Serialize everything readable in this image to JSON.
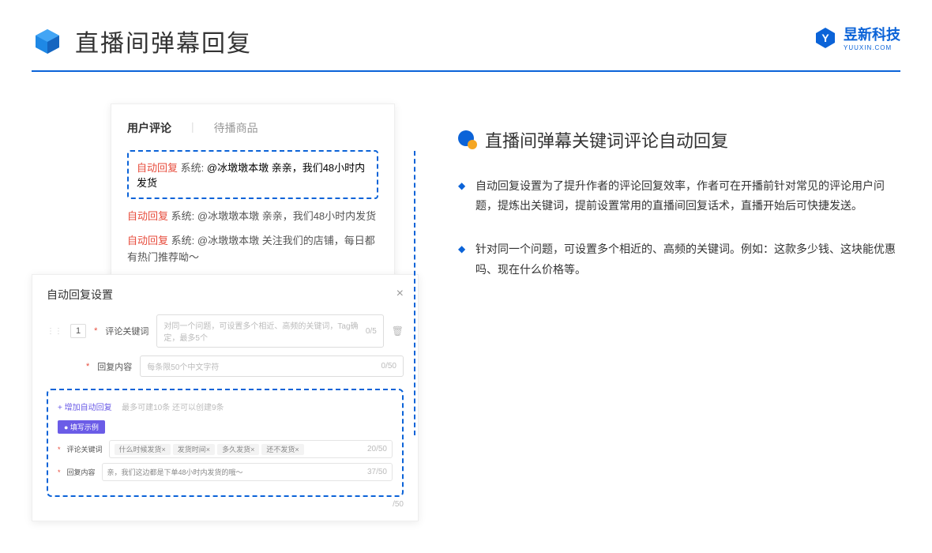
{
  "header": {
    "title": "直播间弹幕回复"
  },
  "logo": {
    "text": "昱新科技",
    "url": "YUUXIN.COM"
  },
  "top_panel": {
    "tab_active": "用户评论",
    "tab_inactive": "待播商品",
    "highlighted_msg": {
      "auto": "自动回复",
      "sys": "系统:",
      "content": "@冰墩墩本墩 亲亲，我们48小时内发货"
    },
    "msg2": {
      "auto": "自动回复",
      "sys": "系统:",
      "content": "@冰墩墩本墩 亲亲，我们48小时内发货"
    },
    "msg3": {
      "auto": "自动回复",
      "sys": "系统:",
      "content": "@冰墩墩本墩 关注我们的店铺，每日都有热门推荐呦～"
    }
  },
  "dialog": {
    "title": "自动回复设置",
    "num": "1",
    "kw_label": "评论关键词",
    "kw_placeholder": "对同一个问题，可设置多个相近、高频的关键词，Tag确定，最多5个",
    "kw_counter": "0/5",
    "content_label": "回复内容",
    "content_placeholder": "每条限50个中文字符",
    "content_counter": "0/50",
    "add_link": "+ 增加自动回复",
    "add_hint": "最多可建10条 还可以创建9条",
    "example_badge": "● 填写示例",
    "ex_kw_label": "评论关键词",
    "ex_tags": [
      "什么时候发货×",
      "发货时间×",
      "多久发货×",
      "还不发货×"
    ],
    "ex_kw_counter": "20/50",
    "ex_content_label": "回复内容",
    "ex_content_value": "亲，我们这边都是下单48小时内发货的哦～",
    "ex_content_counter": "37/50",
    "outer_counter": "/50"
  },
  "right": {
    "title": "直播间弹幕关键词评论自动回复",
    "bullets": [
      "自动回复设置为了提升作者的评论回复效率，作者可在开播前针对常见的评论用户问题，提炼出关键词，提前设置常用的直播间回复话术，直播开始后可快捷发送。",
      "针对同一个问题，可设置多个相近的、高频的关键词。例如：这款多少钱、这块能优惠吗、现在什么价格等。"
    ]
  }
}
